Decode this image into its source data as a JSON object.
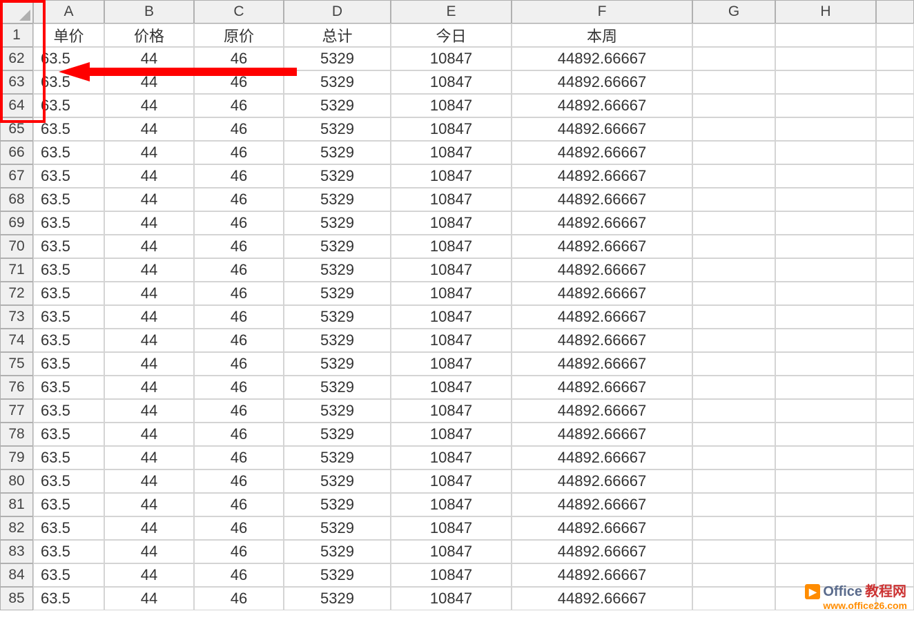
{
  "columns": [
    "A",
    "B",
    "C",
    "D",
    "E",
    "F",
    "G",
    "H",
    ""
  ],
  "headers": {
    "A": "单价",
    "B": "价格",
    "C": "原价",
    "D": "总计",
    "E": "今日",
    "F": "本周"
  },
  "rowNumbers": [
    "1",
    "62",
    "63",
    "64",
    "65",
    "66",
    "67",
    "68",
    "69",
    "70",
    "71",
    "72",
    "73",
    "74",
    "75",
    "76",
    "77",
    "78",
    "79",
    "80",
    "81",
    "82",
    "83",
    "84",
    "85"
  ],
  "dataValues": {
    "A": "63.5",
    "B": "44",
    "C": "46",
    "D": "5329",
    "E": "10847",
    "F": "44892.66667"
  },
  "watermark": {
    "brand": "Office",
    "brandCn": "教程网",
    "url": "www.office26.com"
  }
}
